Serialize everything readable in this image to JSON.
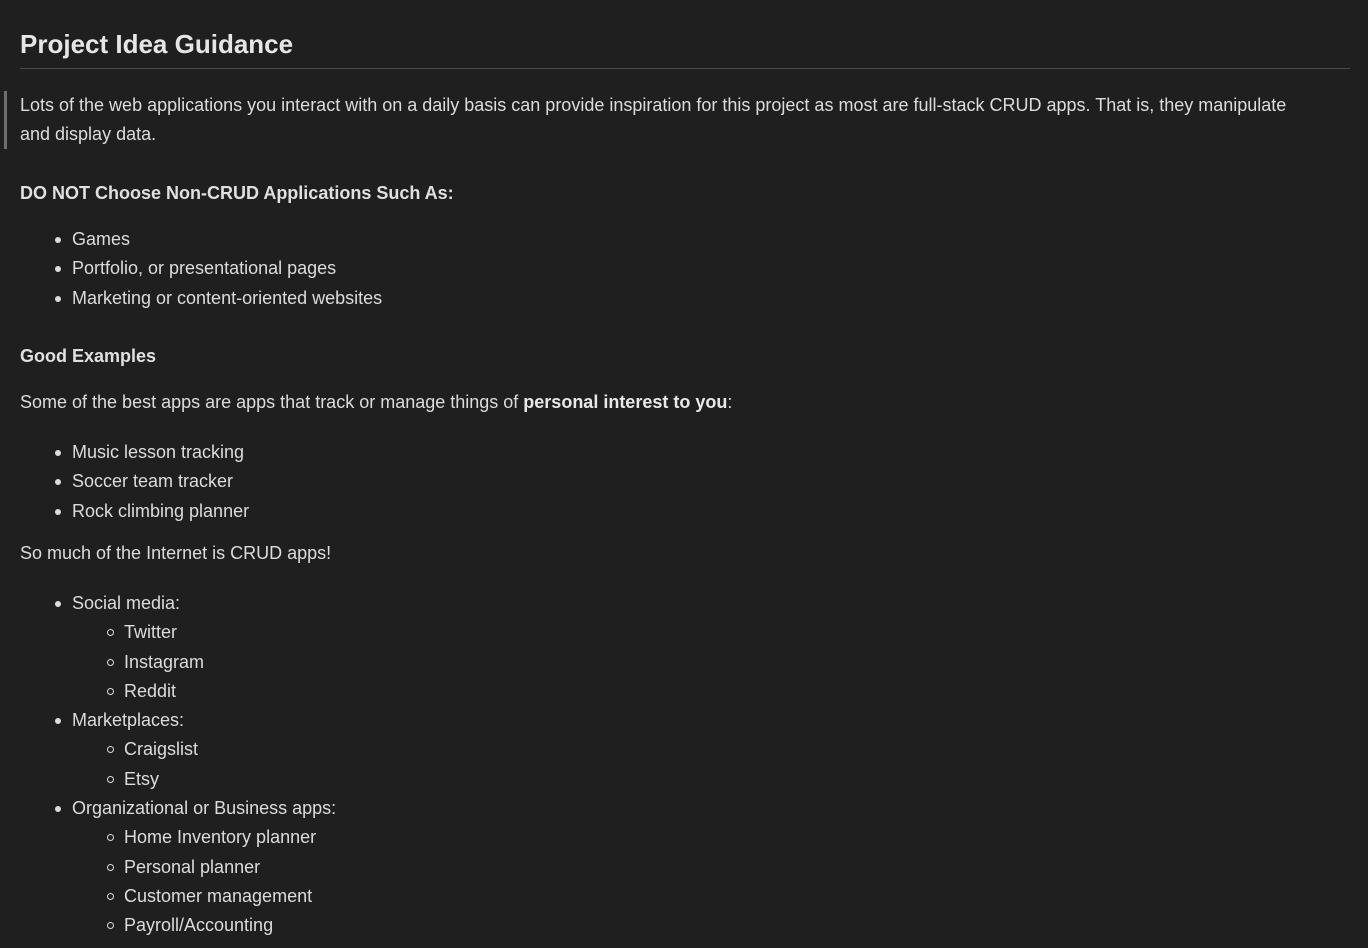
{
  "title": "Project Idea Guidance",
  "intro": "Lots of the web applications you interact with on a daily basis can provide inspiration for this project as most are full-stack CRUD apps. That is, they manipulate and display data.",
  "do_not": {
    "heading": "DO NOT Choose Non-CRUD Applications Such As:",
    "items": [
      "Games",
      "Portfolio, or presentational pages",
      "Marketing or content-oriented websites"
    ]
  },
  "good": {
    "heading": "Good Examples",
    "lead_pre": "Some of the best apps are apps that track or manage things of ",
    "lead_bold": "personal interest to you",
    "lead_post": ":",
    "items": [
      "Music lesson tracking",
      "Soccer team tracker",
      "Rock climbing planner"
    ]
  },
  "internet": {
    "lead": "So much of the Internet is CRUD apps!",
    "groups": [
      {
        "label": "Social media:",
        "items": [
          "Twitter",
          "Instagram",
          "Reddit"
        ]
      },
      {
        "label": "Marketplaces:",
        "items": [
          "Craigslist",
          "Etsy"
        ]
      },
      {
        "label": "Organizational or Business apps:",
        "items": [
          "Home Inventory planner",
          "Personal planner",
          "Customer management",
          "Payroll/Accounting"
        ]
      }
    ]
  }
}
